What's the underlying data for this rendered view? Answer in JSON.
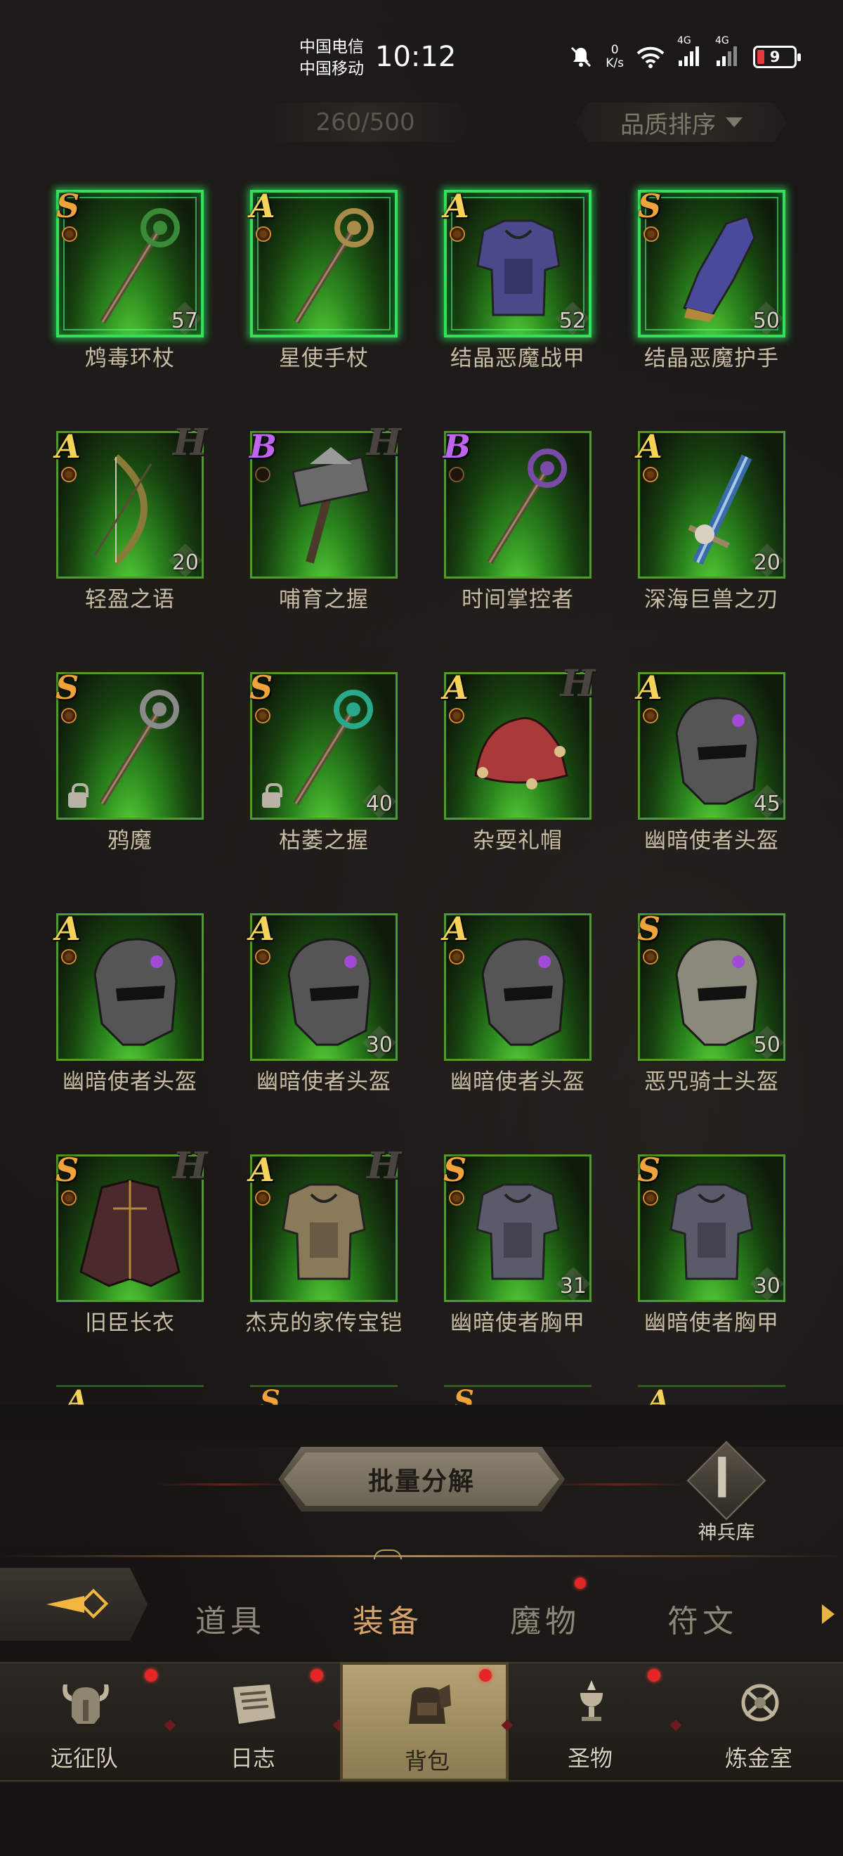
{
  "status_bar": {
    "carrier_1": "中国电信",
    "carrier_2": "中国移动",
    "time": "10:12",
    "speed_value": "0",
    "speed_unit": "K/s",
    "network_1": "4G",
    "network_2": "4G",
    "battery": "9",
    "icons": [
      "mute-bell-icon",
      "wifi-icon",
      "signal-icon",
      "battery-icon"
    ]
  },
  "header": {
    "capacity": "260/500",
    "sort_label": "品质排序"
  },
  "items": [
    {
      "name": "鸩毒环杖",
      "grade": "S",
      "level": "57",
      "glow": true,
      "icon": "staff-icon",
      "color": "#3a8a3a"
    },
    {
      "name": "星使手杖",
      "grade": "A",
      "level": "",
      "glow": true,
      "icon": "staff-icon",
      "color": "#a88a4a"
    },
    {
      "name": "结晶恶魔战甲",
      "grade": "A",
      "level": "52",
      "glow": true,
      "icon": "armor-icon",
      "color": "#4a4a8a"
    },
    {
      "name": "结晶恶魔护手",
      "grade": "S",
      "level": "50",
      "glow": true,
      "icon": "gauntlet-icon",
      "color": "#4a4a9a"
    },
    {
      "name": "轻盈之语",
      "grade": "A",
      "level": "20",
      "glow": false,
      "icon": "bow-icon",
      "color": "#8a7a3a",
      "badge": "H"
    },
    {
      "name": "哺育之握",
      "grade": "B",
      "level": "",
      "glow": false,
      "icon": "hammer-icon",
      "color": "#6a6a6a",
      "badge": "H",
      "empty_mark": true
    },
    {
      "name": "时间掌控者",
      "grade": "B",
      "level": "",
      "glow": false,
      "icon": "staff-icon",
      "color": "#7a4aa8",
      "empty_mark": true
    },
    {
      "name": "深海巨兽之刃",
      "grade": "A",
      "level": "20",
      "glow": false,
      "icon": "sword-icon",
      "color": "#3a6aa8"
    },
    {
      "name": "鸦魔",
      "grade": "S",
      "level": "",
      "glow": false,
      "icon": "staff-icon",
      "color": "#8a8a8a",
      "locked": true
    },
    {
      "name": "枯萎之握",
      "grade": "S",
      "level": "40",
      "glow": false,
      "icon": "staff-icon",
      "color": "#2aa88a",
      "locked": true
    },
    {
      "name": "杂耍礼帽",
      "grade": "A",
      "level": "",
      "glow": false,
      "icon": "hat-icon",
      "color": "#a83a3a",
      "badge": "H"
    },
    {
      "name": "幽暗使者头盔",
      "grade": "A",
      "level": "45",
      "glow": false,
      "icon": "helmet-icon",
      "color": "#555555"
    },
    {
      "name": "幽暗使者头盔",
      "grade": "A",
      "level": "",
      "glow": false,
      "icon": "helmet-icon",
      "color": "#555555"
    },
    {
      "name": "幽暗使者头盔",
      "grade": "A",
      "level": "30",
      "glow": false,
      "icon": "helmet-icon",
      "color": "#555555"
    },
    {
      "name": "幽暗使者头盔",
      "grade": "A",
      "level": "",
      "glow": false,
      "icon": "helmet-icon",
      "color": "#555555"
    },
    {
      "name": "恶咒骑士头盔",
      "grade": "S",
      "level": "50",
      "glow": false,
      "icon": "helmet-icon",
      "color": "#8a8a7a"
    },
    {
      "name": "旧臣长衣",
      "grade": "S",
      "level": "",
      "glow": false,
      "icon": "coat-icon",
      "color": "#4a2a2a",
      "badge": "H"
    },
    {
      "name": "杰克的家传宝铠",
      "grade": "A",
      "level": "",
      "glow": false,
      "icon": "armor-icon",
      "color": "#8a7a5a",
      "badge": "H"
    },
    {
      "name": "幽暗使者胸甲",
      "grade": "S",
      "level": "31",
      "glow": false,
      "icon": "armor-icon",
      "color": "#5a5a6a"
    },
    {
      "name": "幽暗使者胸甲",
      "grade": "S",
      "level": "30",
      "glow": false,
      "icon": "armor-icon",
      "color": "#5a5a6a"
    }
  ],
  "partial_row_grades": [
    "A",
    "S",
    "S",
    "A"
  ],
  "actions": {
    "batch_decompose": "批量分解",
    "arsenal": "神兵库"
  },
  "tabs": [
    {
      "label": "道具",
      "active": false,
      "dot": false
    },
    {
      "label": "装备",
      "active": true,
      "dot": false
    },
    {
      "label": "魔物",
      "active": false,
      "dot": true
    },
    {
      "label": "符文",
      "active": false,
      "dot": false
    }
  ],
  "nav": [
    {
      "label": "远征队",
      "icon": "viking-helmet-icon",
      "active": false,
      "dot": true
    },
    {
      "label": "日志",
      "icon": "scroll-icon",
      "active": false,
      "dot": true
    },
    {
      "label": "背包",
      "icon": "backpack-icon",
      "active": true,
      "dot": true
    },
    {
      "label": "圣物",
      "icon": "chalice-icon",
      "active": false,
      "dot": true
    },
    {
      "label": "炼金室",
      "icon": "alchemy-icon",
      "active": false,
      "dot": false
    }
  ],
  "colors": {
    "grade_s": "#f0a33a",
    "grade_a": "#f5d25a",
    "grade_b": "#c064f0",
    "slot_green": "#3cba2a",
    "active_tab": "#d7a36a",
    "notification": "#e52626"
  }
}
